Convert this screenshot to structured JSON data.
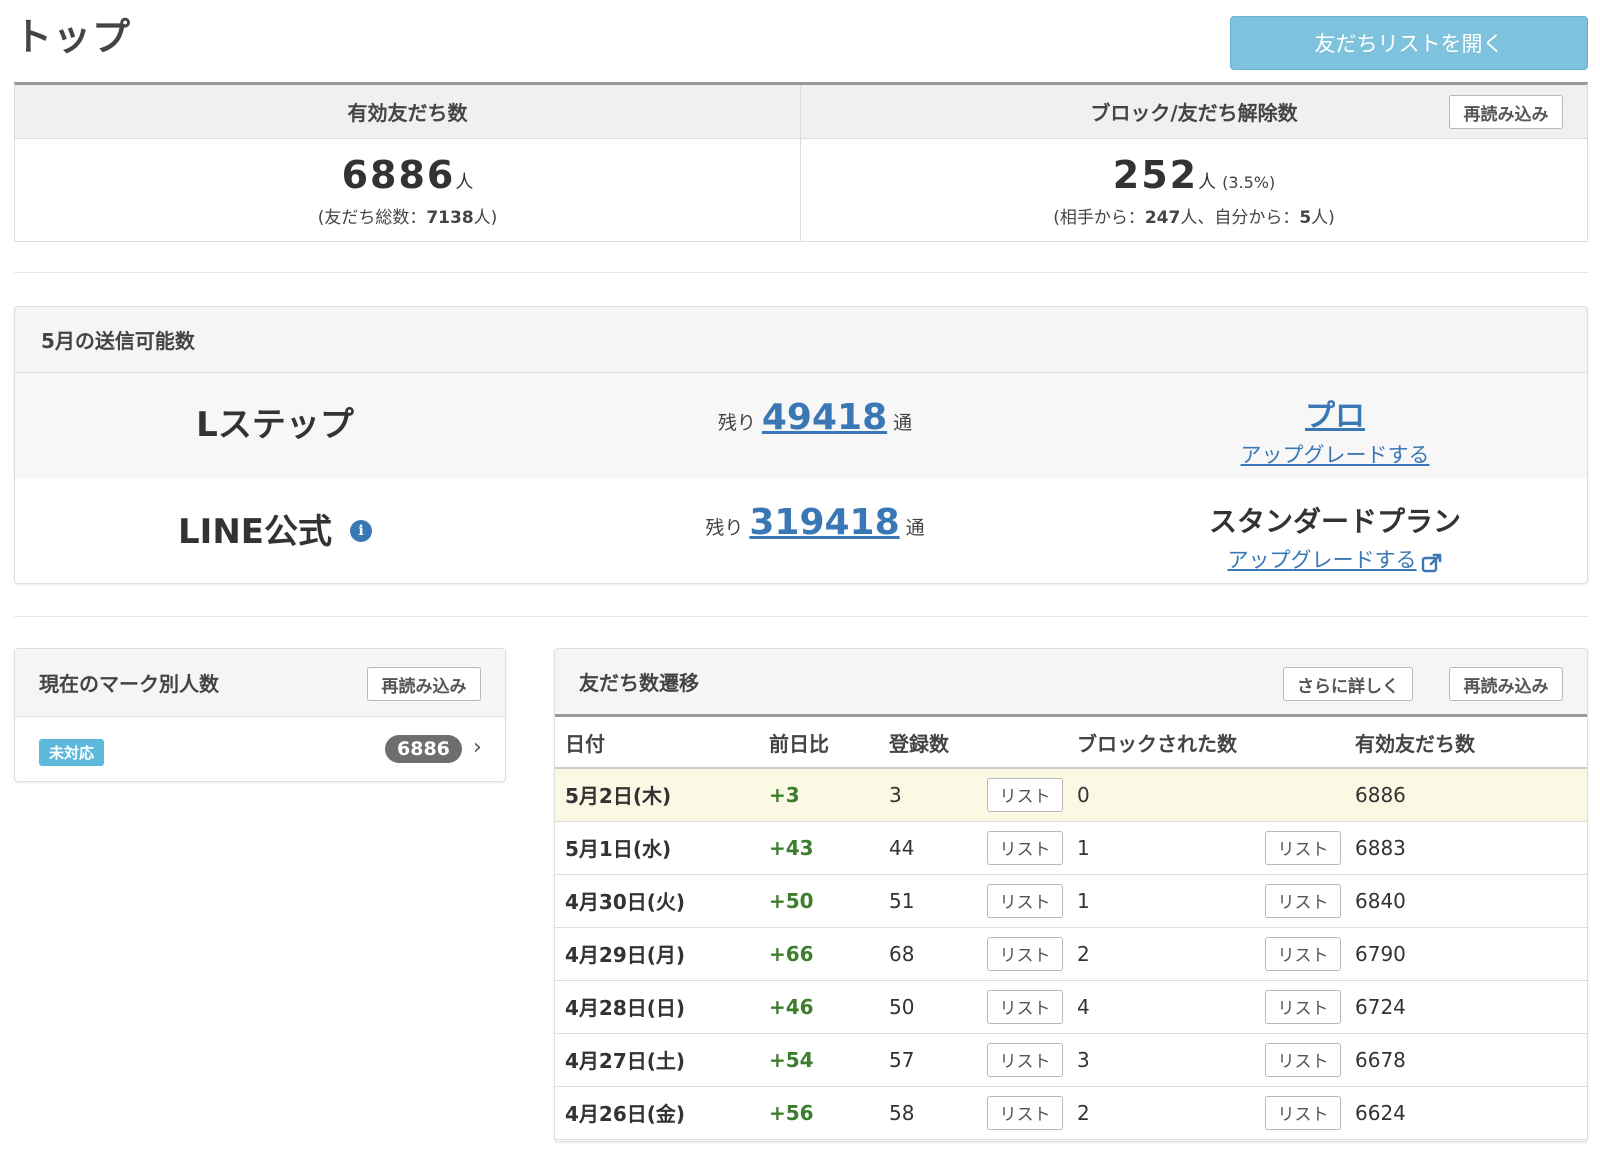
{
  "page": {
    "title": "トップ",
    "open_list_button": "友だちリストを開く"
  },
  "friends": {
    "header": "有効友だち数",
    "count": "6886",
    "unit": "人",
    "sub_prefix": "(友だち総数：",
    "sub_total": "7138",
    "sub_suffix": "人)"
  },
  "blocks": {
    "header": "ブロック/友だち解除数",
    "reload": "再読み込み",
    "count": "252",
    "unit": "人",
    "percent": "(3.5%)",
    "sub_prefix": "(相手から：",
    "from_other": "247",
    "sub_mid": "人、自分から：",
    "from_self": "5",
    "sub_suffix": "人)"
  },
  "send": {
    "header": "5月の送信可能数",
    "rows": [
      {
        "name": "Lステップ",
        "remain_label": "残り",
        "remain": "49418",
        "unit": "通",
        "plan": "プロ",
        "upgrade": "アップグレードする"
      },
      {
        "name": "LINE公式",
        "remain_label": "残り",
        "remain": "319418",
        "unit": "通",
        "plan": "スタンダードプラン",
        "upgrade": "アップグレードする"
      }
    ]
  },
  "marks": {
    "header": "現在のマーク別人数",
    "reload": "再読み込み",
    "items": [
      {
        "label": "未対応",
        "count": "6886"
      }
    ]
  },
  "trend": {
    "header": "友だち数遷移",
    "detail_button": "さらに詳しく",
    "reload": "再読み込み",
    "columns": [
      "日付",
      "前日比",
      "登録数",
      "ブロックされた数",
      "有効友だち数"
    ],
    "list_label": "リスト",
    "rows": [
      {
        "date": "5月2日(木)",
        "diff": "+3",
        "registered": "3",
        "blocked": "0",
        "valid": "6886"
      },
      {
        "date": "5月1日(水)",
        "diff": "+43",
        "registered": "44",
        "blocked": "1",
        "valid": "6883"
      },
      {
        "date": "4月30日(火)",
        "diff": "+50",
        "registered": "51",
        "blocked": "1",
        "valid": "6840"
      },
      {
        "date": "4月29日(月)",
        "diff": "+66",
        "registered": "68",
        "blocked": "2",
        "valid": "6790"
      },
      {
        "date": "4月28日(日)",
        "diff": "+46",
        "registered": "50",
        "blocked": "4",
        "valid": "6724"
      },
      {
        "date": "4月27日(土)",
        "diff": "+54",
        "registered": "57",
        "blocked": "3",
        "valid": "6678"
      },
      {
        "date": "4月26日(金)",
        "diff": "+56",
        "registered": "58",
        "blocked": "2",
        "valid": "6624"
      }
    ]
  },
  "colors": {
    "accent": "#7ec2de",
    "link": "#3a78b5",
    "positive": "#3c7d2e",
    "highlight_row": "#fbf8e3",
    "badge": "#5eb8db"
  }
}
